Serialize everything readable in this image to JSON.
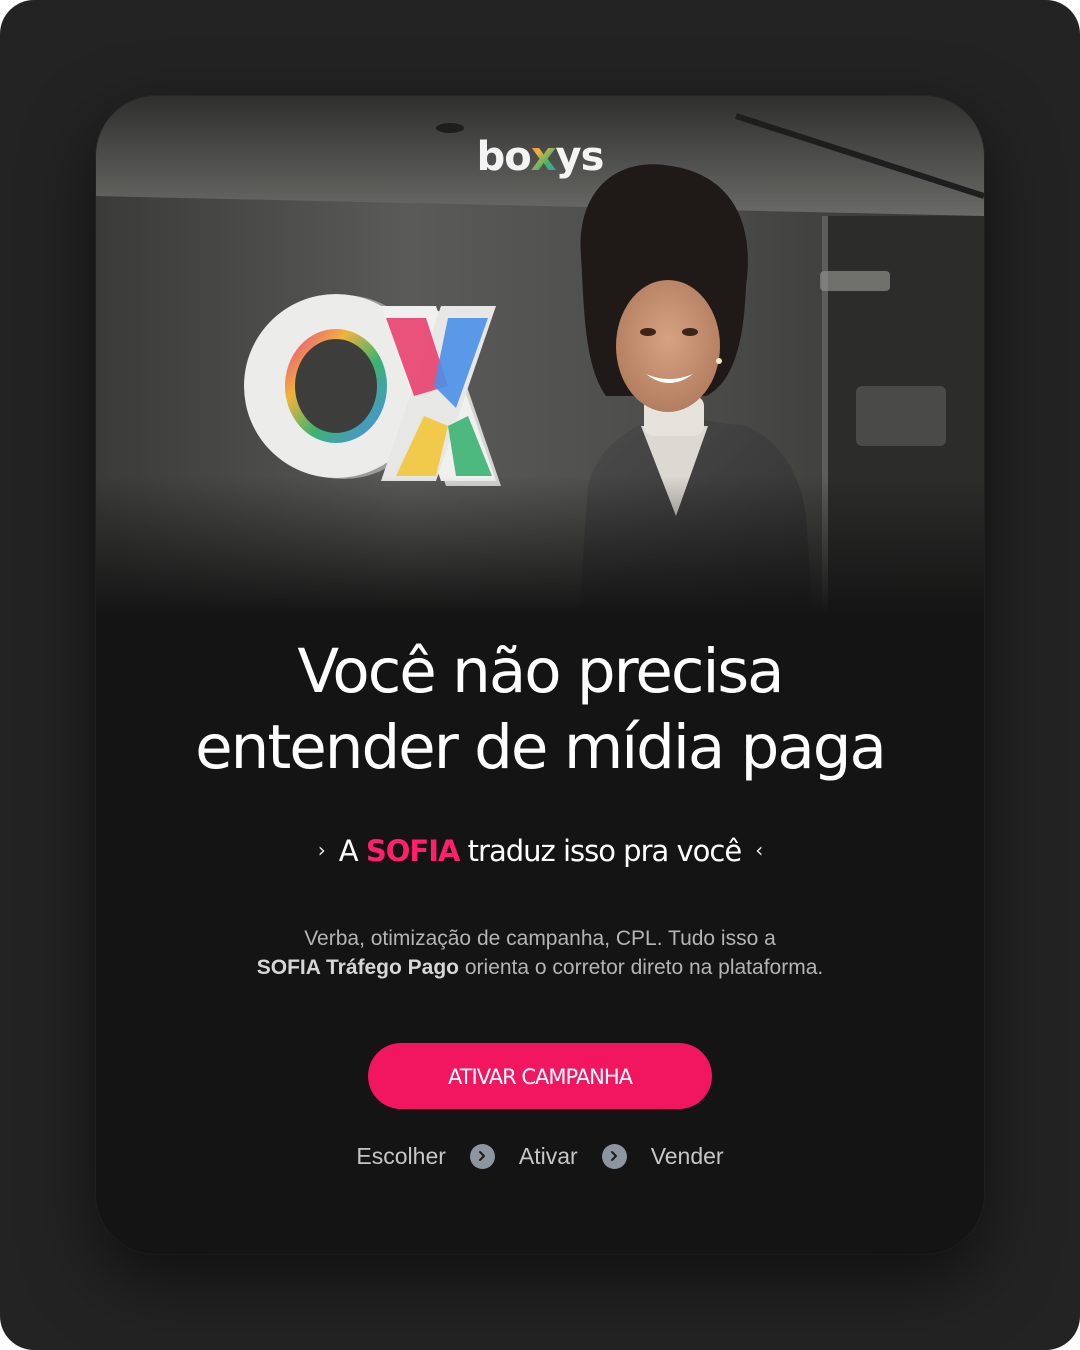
{
  "brand": {
    "logo_text": "boxys",
    "logo_letters": [
      "bo",
      "x",
      "ys"
    ]
  },
  "hero": {
    "sign_letters": "OX"
  },
  "headline": {
    "line1": "Você não precisa",
    "line2": "entender de mídia paga"
  },
  "subheadline": {
    "prefix": "A",
    "highlight": "SOFIA",
    "suffix": "traduz isso pra você",
    "chevron_left": "›",
    "chevron_right": "‹"
  },
  "body": {
    "line1": "Verba, otimização de campanha, CPL. Tudo isso a",
    "line2_bold": "SOFIA Tráfego Pago",
    "line2_rest": "orienta o corretor direto na plataforma."
  },
  "cta": {
    "label": "ATIVAR CAMPANHA"
  },
  "steps": {
    "items": [
      "Escolher",
      "Ativar",
      "Vender"
    ],
    "separator_icon": "chevron-right-circle-icon"
  },
  "colors": {
    "accent": "#f21560",
    "accent_text": "#ff1f6b",
    "background": "#141414",
    "frame": "#232323"
  }
}
